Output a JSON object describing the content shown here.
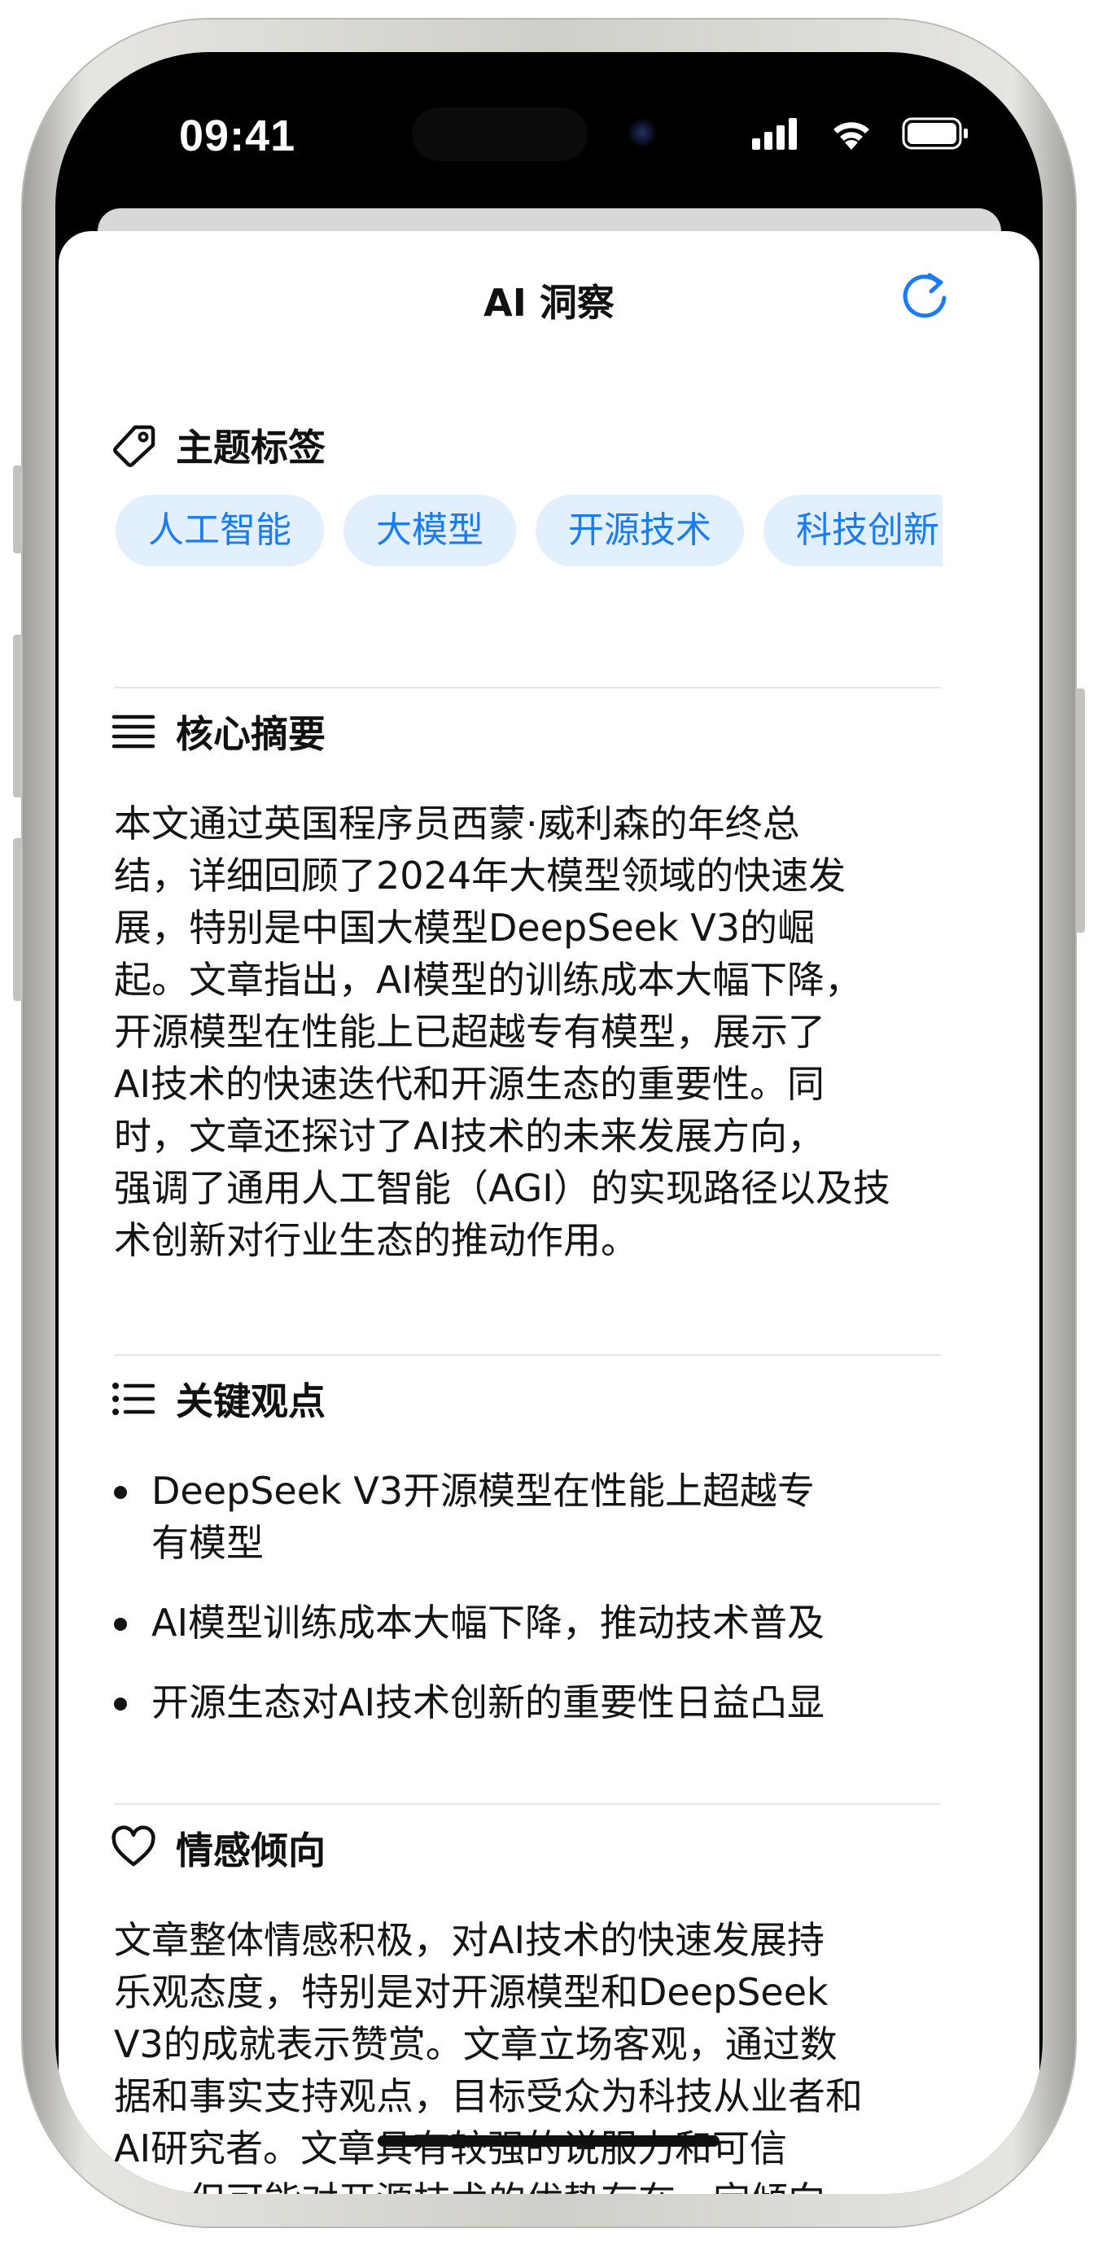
{
  "status_bar": {
    "time": "09:41"
  },
  "nav": {
    "title": "AI 洞察"
  },
  "tags_section": {
    "title": "主题标签",
    "tags": [
      "人工智能",
      "大模型",
      "开源技术",
      "科技创新"
    ]
  },
  "summary": {
    "title": "核心摘要",
    "lines": [
      "本文通过英国程序员西蒙·威利森的年终总",
      "结，详细回顾了2024年大模型领域的快速发",
      "展，特别是中国大模型DeepSeek V3的崛",
      "起。文章指出，AI模型的训练成本大幅下降，",
      "开源模型在性能上已超越专有模型，展示了",
      "AI技术的快速迭代和开源生态的重要性。同",
      "时，文章还探讨了AI技术的未来发展方向，",
      "强调了通用人工智能（AGI）的实现路径以及技",
      "术创新对行业生态的推动作用。"
    ]
  },
  "key_points": {
    "title": "关键观点",
    "items": [
      [
        "DeepSeek V3开源模型在性能上超越专",
        "有模型"
      ],
      [
        "AI模型训练成本大幅下降，推动技术普及"
      ],
      [
        "开源生态对AI技术创新的重要性日益凸显"
      ]
    ]
  },
  "sentiment": {
    "title": "情感倾向",
    "lines": [
      "文章整体情感积极，对AI技术的快速发展持",
      "乐观态度，特别是对开源模型和DeepSeek",
      "V3的成就表示赞赏。文章立场客观，通过数",
      "据和事实支持观点，目标受众为科技从业者和",
      "AI研究者。文章具有较强的说服力和可信",
      "度，但可能对开源技术的优势存在一定倾向。"
    ]
  },
  "colors": {
    "accent": "#1a7cf0",
    "tag_bg": "#e2efff",
    "text": "#141414"
  },
  "icons": {
    "refresh": "refresh-icon",
    "tag": "tag-icon",
    "summary": "text-lines-icon",
    "key_points": "bulleted-list-icon",
    "sentiment": "heart-icon"
  }
}
